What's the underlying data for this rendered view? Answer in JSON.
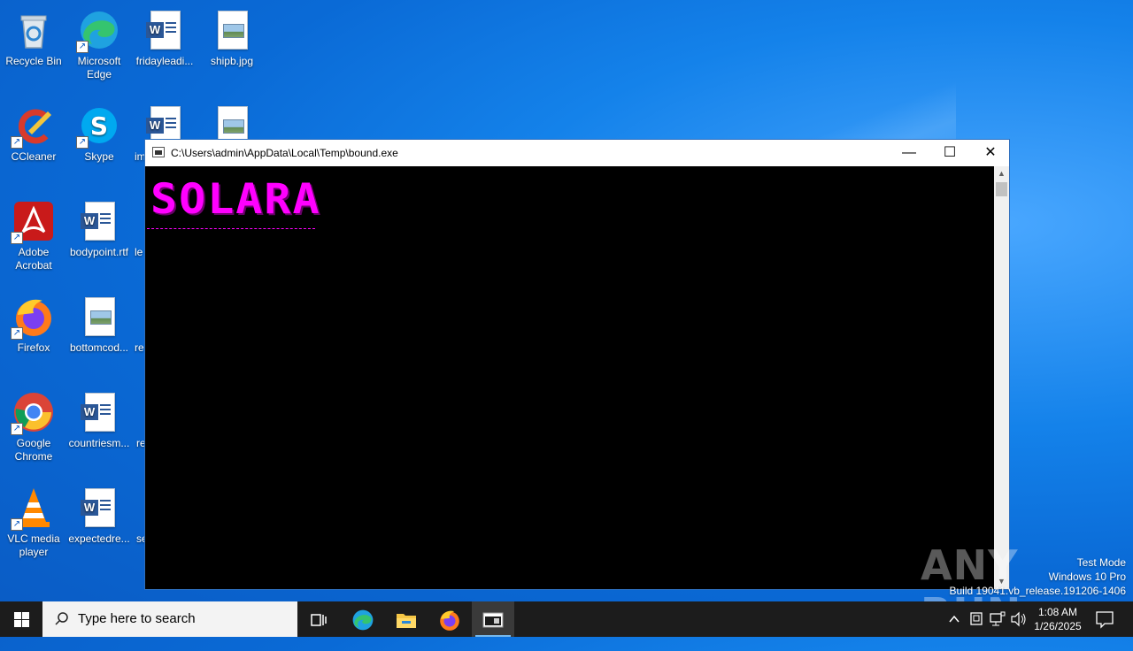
{
  "desktop": {
    "icons": [
      {
        "label": "Recycle Bin"
      },
      {
        "label": "Microsoft Edge"
      },
      {
        "label": "fridayleadi..."
      },
      {
        "label": "shipb.jpg"
      },
      {
        "label": "CCleaner"
      },
      {
        "label": "Skype"
      },
      {
        "label": "im"
      },
      {
        "label": "Adobe Acrobat"
      },
      {
        "label": "bodypoint.rtf"
      },
      {
        "label": "le"
      },
      {
        "label": "Firefox"
      },
      {
        "label": "bottomcod..."
      },
      {
        "label": "re"
      },
      {
        "label": "Google Chrome"
      },
      {
        "label": "countriesm..."
      },
      {
        "label": "re"
      },
      {
        "label": "VLC media player"
      },
      {
        "label": "expectedre..."
      },
      {
        "label": "se"
      }
    ]
  },
  "window": {
    "title": "C:\\Users\\admin\\AppData\\Local\\Temp\\bound.exe",
    "minimize_glyph": "—",
    "maximize_glyph": "☐",
    "close_glyph": "✕",
    "console_banner": "SOLARA",
    "scroll_up_glyph": "▲",
    "scroll_down_glyph": "▼"
  },
  "watermark": {
    "line1": "Test Mode",
    "line2": "Windows 10 Pro",
    "line3": "Build 19041.vb_release.191206-1406",
    "brand": "ANY RUN"
  },
  "taskbar": {
    "search_placeholder": "Type here to search",
    "time": "1:08 AM",
    "date": "1/26/2025"
  },
  "colors": {
    "console_text": "#ff00ff",
    "desktop_bg": "#0a6ad6",
    "taskbar_bg": "#1c1c1c"
  }
}
